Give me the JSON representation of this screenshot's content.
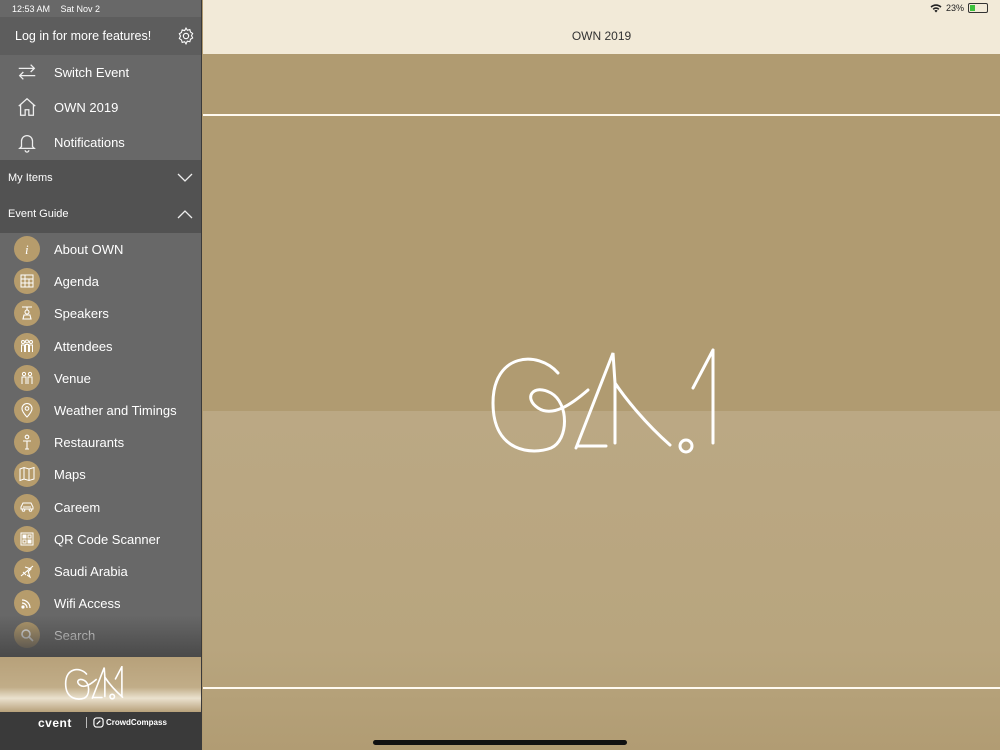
{
  "status_bar": {
    "time": "12:53 AM",
    "date": "Sat Nov 2",
    "battery": "23%"
  },
  "sidebar": {
    "login_text": "Log in for more features!",
    "top_items": [
      {
        "label": "Switch Event",
        "icon": "switch-arrows-icon"
      },
      {
        "label": "OWN 2019",
        "icon": "home-icon"
      },
      {
        "label": "Notifications",
        "icon": "bell-icon"
      }
    ],
    "sections": {
      "my_items": "My Items",
      "event_guide": "Event Guide"
    },
    "guide_items": [
      {
        "label": "About OWN",
        "icon": "info-icon"
      },
      {
        "label": "Agenda",
        "icon": "agenda-icon"
      },
      {
        "label": "Speakers",
        "icon": "speaker-icon"
      },
      {
        "label": "Attendees",
        "icon": "attendees-icon"
      },
      {
        "label": "Venue",
        "icon": "venue-icon"
      },
      {
        "label": "Weather and Timings",
        "icon": "location-pin-icon"
      },
      {
        "label": "Restaurants",
        "icon": "restaurant-icon"
      },
      {
        "label": "Maps",
        "icon": "map-icon"
      },
      {
        "label": "Careem",
        "icon": "car-icon"
      },
      {
        "label": "QR Code Scanner",
        "icon": "qr-code-icon"
      },
      {
        "label": "Saudi Arabia",
        "icon": "airplane-icon"
      },
      {
        "label": "Wifi Access",
        "icon": "wifi-icon"
      },
      {
        "label": "Search",
        "icon": "search-icon"
      }
    ],
    "footer": {
      "brand": "cvent",
      "partner": "CrowdCompass"
    }
  },
  "main": {
    "title": "OWN 2019"
  },
  "colors": {
    "accent_gold": "#b09a70",
    "header_cream": "#f2ead8",
    "sidebar_gray": "#686868"
  }
}
